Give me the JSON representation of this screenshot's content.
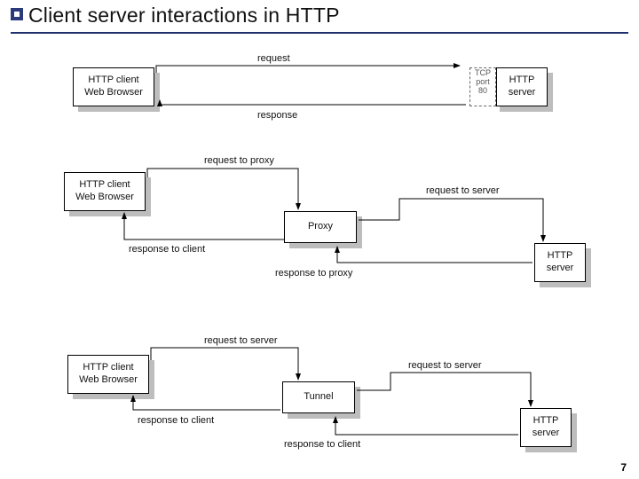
{
  "title": "Client server interactions in HTTP",
  "page_number": "7",
  "nodes": {
    "client1": "HTTP client\nWeb Browser",
    "server1": "HTTP\nserver",
    "port1": "TCP\nport\n80",
    "client2": "HTTP client\nWeb Browser",
    "proxy": "Proxy",
    "server2": "HTTP\nserver",
    "client3": "HTTP client\nWeb Browser",
    "tunnel": "Tunnel",
    "server3": "HTTP\nserver"
  },
  "labels": {
    "d1_request": "request",
    "d1_response": "response",
    "d2_req_proxy": "request to proxy",
    "d2_req_server": "request to server",
    "d2_resp_client": "response to client",
    "d2_resp_proxy": "response to proxy",
    "d3_req_server_a": "request to server",
    "d3_req_server_b": "request to server",
    "d3_resp_client_a": "response to client",
    "d3_resp_client_b": "response to client"
  }
}
